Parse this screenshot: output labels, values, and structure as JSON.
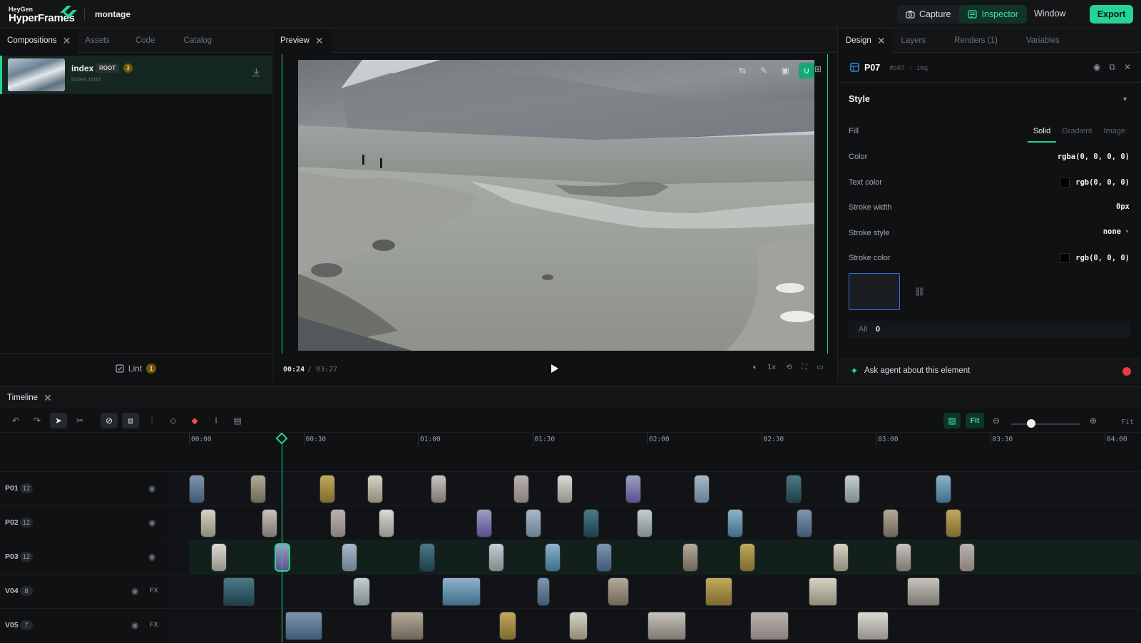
{
  "app": {
    "brand_small": "HeyGen",
    "brand_big": "HyperFrames",
    "project": "montage",
    "actions": [
      {
        "label": "Capture",
        "icon": "camera-icon"
      },
      {
        "label": "Inspector",
        "icon": "inspector-icon",
        "active": true
      }
    ],
    "window_label": "Window",
    "export_label": "Export",
    "accent": "#25d394"
  },
  "left_panel": {
    "tabs": [
      "Compositions",
      "Assets",
      "Code",
      "Catalog"
    ],
    "active_tab": "Compositions",
    "composition": {
      "name": "index",
      "badge": "ROOT",
      "count": "3",
      "file": "index.html"
    },
    "lint_label": "Lint",
    "lint_count": "1"
  },
  "preview": {
    "tab": "Preview",
    "time_current": "00:24",
    "time_separator": "/",
    "time_total": "03:27",
    "speed": "1x"
  },
  "inspector": {
    "tabs": [
      "Design",
      "Layers",
      "Renders (1)",
      "Variables"
    ],
    "element_name": "P07",
    "element_id": "#p07 · img",
    "section_title": "Style",
    "fill_label": "Fill",
    "fill_modes": [
      "Solid",
      "Gradient",
      "Image"
    ],
    "properties": [
      {
        "label": "Color",
        "value": "rgba(0, 0, 0, 0)",
        "swatch": false
      },
      {
        "label": "Text color",
        "value": "rgb(0, 0, 0)",
        "swatch": true
      },
      {
        "label": "Stroke width",
        "value": "0px",
        "swatch": false
      },
      {
        "label": "Stroke style",
        "value": "none",
        "swatch": false
      },
      {
        "label": "Stroke color",
        "value": "rgb(0, 0, 0)",
        "swatch": true
      }
    ],
    "radius_all_label": "All",
    "radius_all_value": "0",
    "ask_label": "Ask agent about this element"
  },
  "timeline": {
    "tab": "Timeline",
    "fit_label": "Fit",
    "fit_text": "Fit",
    "ruler": [
      "00:00",
      "00:30",
      "01:00",
      "01:30",
      "02:00",
      "02:30",
      "03:00",
      "03:30",
      "04:00"
    ],
    "tracks": [
      {
        "name": "P01",
        "count": "12"
      },
      {
        "name": "P02",
        "count": "12"
      },
      {
        "name": "P03",
        "count": "12"
      },
      {
        "name": "V04",
        "count": "8",
        "fx": "FX"
      },
      {
        "name": "V05",
        "count": "7",
        "fx": "FX"
      }
    ]
  }
}
